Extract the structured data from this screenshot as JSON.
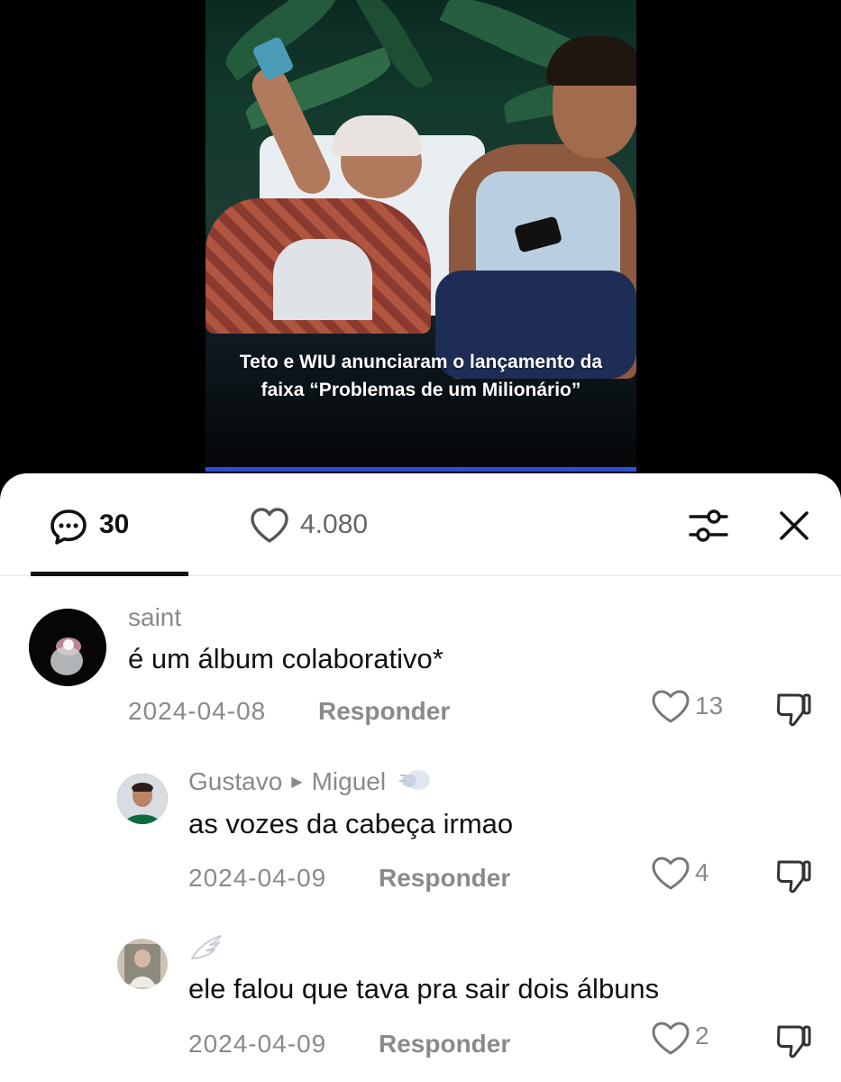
{
  "video": {
    "caption_line1": "Teto e WIU anunciaram o lançamento da",
    "caption_line2": "faixa “Problemas de um Milionário”",
    "progress": 1.0
  },
  "tabs": {
    "comments_count": "30",
    "likes_count": "4.080",
    "icons": {
      "comments": "comment-bubble-icon",
      "likes": "heart-icon",
      "filter": "sliders-icon",
      "close": "close-icon"
    }
  },
  "comments": [
    {
      "username": "saint",
      "text": "é um álbum colaborativo*",
      "date": "2024-04-08",
      "reply_label": "Responder",
      "likes": "13"
    },
    {
      "username": "Gustavo",
      "reply_to": "Miguel",
      "text": "as vozes da cabeça irmao",
      "date": "2024-04-09",
      "reply_label": "Responder",
      "likes": "4"
    },
    {
      "username": "",
      "text": "ele falou que tava pra sair dois álbuns",
      "date": "2024-04-09",
      "reply_label": "Responder",
      "likes": "2"
    }
  ],
  "colors": {
    "accent_progress": "#2d4fd6",
    "text_primary": "#111111",
    "text_secondary": "#8a8a8a"
  }
}
